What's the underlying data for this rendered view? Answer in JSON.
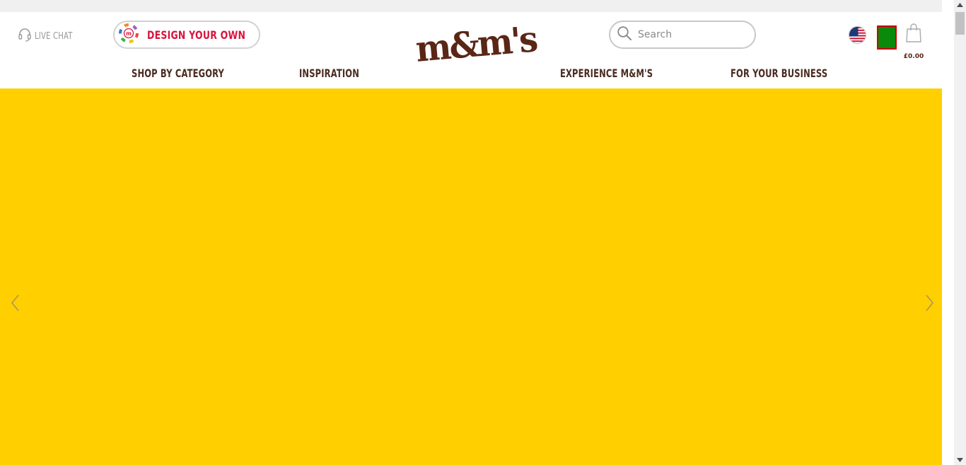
{
  "header": {
    "live_chat_label": "LIVE CHAT",
    "design_your_own_label": "DESIGN YOUR OWN",
    "logo_text": "m&m's",
    "logo_reg": "®",
    "search_placeholder": "Search",
    "cart_total": "£0.00"
  },
  "nav": {
    "items": [
      {
        "label": "SHOP BY CATEGORY"
      },
      {
        "label": "INSPIRATION"
      },
      {
        "label": "EXPERIENCE M&M'S"
      },
      {
        "label": "FOR YOUR BUSINESS"
      }
    ]
  },
  "hero": {
    "background_color": "#FFCF00"
  },
  "colors": {
    "brand_brown": "#5A2615",
    "accent_red": "#D8143D",
    "hero_yellow": "#FFCF00"
  },
  "icons": {
    "live_chat": "headset-icon",
    "design": "mm-color-wheel-icon",
    "search": "search-icon",
    "flag": "us-flag-icon",
    "cart": "shopping-bag-icon",
    "prev": "chevron-left-icon",
    "next": "chevron-right-icon"
  }
}
